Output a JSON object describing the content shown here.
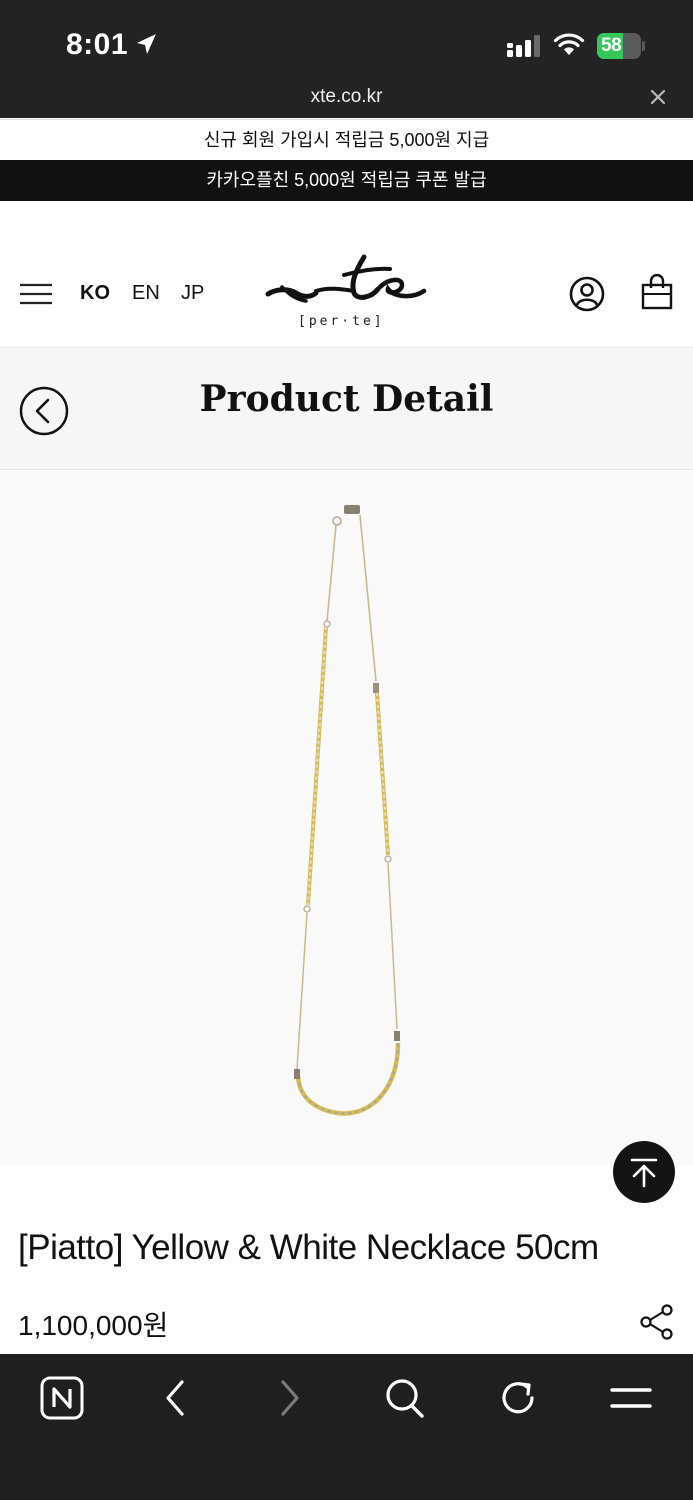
{
  "status": {
    "time": "8:01",
    "battery_percent": 58
  },
  "url_bar": {
    "url": "xte.co.kr"
  },
  "banners": {
    "signup": "신규 회원 가입시 적립금 5,000원 지급",
    "kakao": "카카오플친 5,000원 적립금 쿠폰 발급"
  },
  "header": {
    "languages": [
      "KO",
      "EN",
      "JP"
    ],
    "logo_sub": "[per·te]"
  },
  "page": {
    "title": "Product Detail"
  },
  "product": {
    "name": "[Piatto] Yellow & White Necklace 50cm",
    "price": "1,100,000원"
  },
  "icons": {
    "menu": "hamburger-menu-icon",
    "user": "user-account-icon",
    "bag": "shopping-bag-icon",
    "back": "back-arrow-icon",
    "top": "scroll-to-top-icon",
    "share": "share-icon"
  },
  "colors": {
    "status_bg": "#232323",
    "banner_black": "#111111",
    "title_bar_bg": "#f6f6f6",
    "battery_green": "#34c759",
    "toolbar_bg": "#1f1f1f"
  }
}
